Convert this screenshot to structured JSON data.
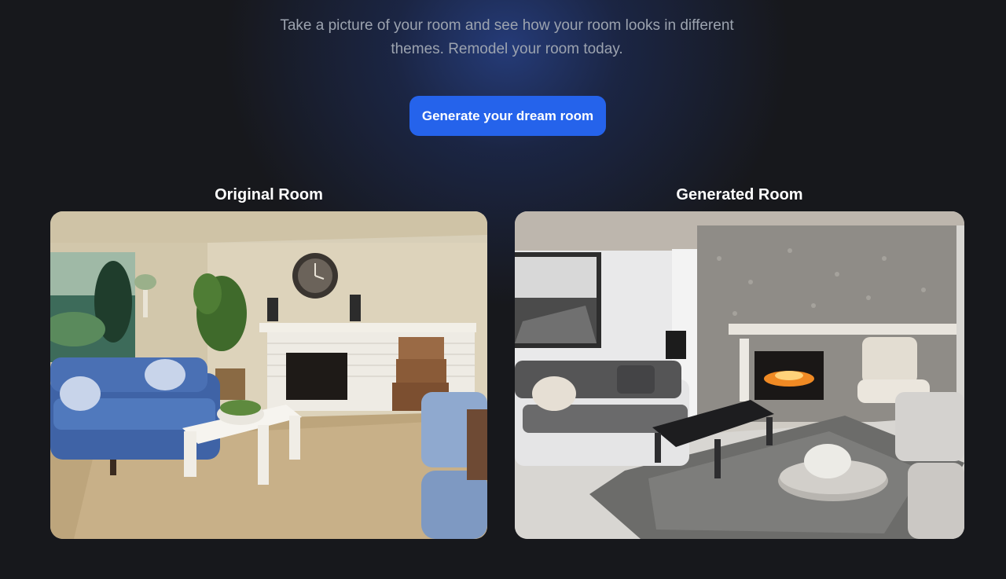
{
  "hero": {
    "tagline_line1": "Take a picture of your room and see how your room looks in different",
    "tagline_line2": "themes. Remodel your room today.",
    "cta_label": "Generate your dream room"
  },
  "comparison": {
    "original_label": "Original Room",
    "generated_label": "Generated Room"
  },
  "colors": {
    "background": "#17181c",
    "accent": "#2563eb",
    "tagline": "#9ca3af",
    "heading": "#ffffff"
  }
}
